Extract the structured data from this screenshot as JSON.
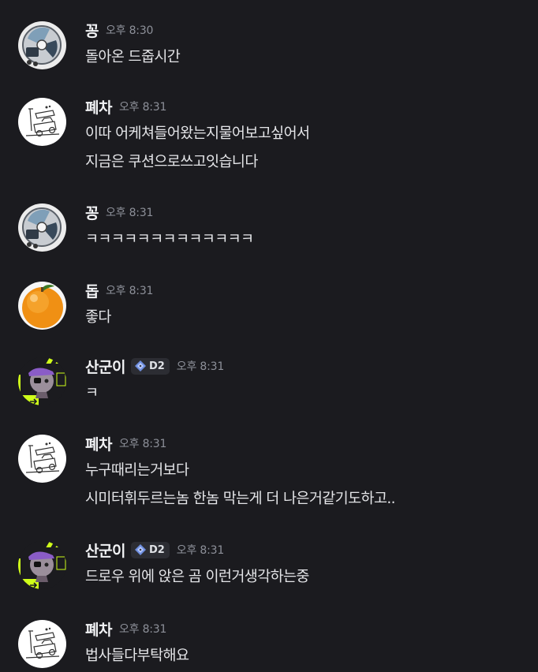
{
  "messages": [
    {
      "user": "꽁",
      "time": "오후 8:30",
      "avatar": "cd-avatar-icon",
      "lines": [
        "돌아온 드줍시간"
      ]
    },
    {
      "user": "폐차",
      "time": "오후 8:31",
      "avatar": "scrapped-car-sketch-icon",
      "lines": [
        "이따 어케쳐들어왔는지물어보고싶어서",
        "지금은 쿠션으로쓰고잇습니다"
      ]
    },
    {
      "user": "꽁",
      "time": "오후 8:31",
      "avatar": "cd-avatar-icon",
      "lines": [
        "ㅋㅋㅋㅋㅋㅋㅋㅋㅋㅋㅋㅋㅋ"
      ]
    },
    {
      "user": "돕",
      "time": "오후 8:31",
      "avatar": "orange-avatar-icon",
      "lines": [
        "좋다"
      ]
    },
    {
      "user": "산군이",
      "badge": "D2",
      "time": "오후 8:31",
      "avatar": "pirate-cat-avatar-icon",
      "lines": [
        "ㅋ"
      ]
    },
    {
      "user": "폐차",
      "time": "오후 8:31",
      "avatar": "scrapped-car-sketch-icon",
      "lines": [
        "누구때리는거보다",
        "시미터휘두르는놈 한놈 막는게 더 나은거같기도하고.."
      ]
    },
    {
      "user": "산군이",
      "badge": "D2",
      "time": "오후 8:31",
      "avatar": "pirate-cat-avatar-icon",
      "lines": [
        "드로우 위에 앉은 곰 이런거생각하는중"
      ]
    },
    {
      "user": "폐차",
      "time": "오후 8:31",
      "avatar": "scrapped-car-sketch-icon",
      "lines": [
        "법사들다부탁해요"
      ]
    }
  ],
  "colors": {
    "background": "#1b1b1f",
    "username": "#f2f3f5",
    "timestamp": "#8d9099",
    "text": "#e4e5e8",
    "badge_bg": "#2c2d33",
    "badge_icon": "#6f8fe0"
  }
}
